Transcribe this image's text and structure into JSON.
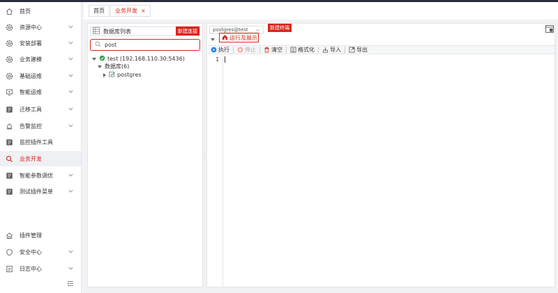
{
  "sidebar": {
    "items": [
      {
        "label": "首页",
        "icon": "home-icon",
        "expandable": false,
        "active": false
      },
      {
        "label": "资源中心",
        "icon": "gear-icon",
        "expandable": true,
        "active": false
      },
      {
        "label": "安装部署",
        "icon": "gear-icon",
        "expandable": true,
        "active": false
      },
      {
        "label": "业务建模",
        "icon": "gear-icon",
        "expandable": true,
        "active": false
      },
      {
        "label": "基础运维",
        "icon": "gear-icon",
        "expandable": true,
        "active": false
      },
      {
        "label": "智能运维",
        "icon": "monitor-icon",
        "expandable": true,
        "active": false
      },
      {
        "label": "迁移工具",
        "icon": "document-icon",
        "expandable": true,
        "active": false
      },
      {
        "label": "告警监控",
        "icon": "alarm-icon",
        "expandable": true,
        "active": false
      },
      {
        "label": "监控插件工具",
        "icon": "document-icon",
        "expandable": false,
        "active": false
      },
      {
        "label": "业务开发",
        "icon": "search-icon",
        "expandable": false,
        "active": true
      },
      {
        "label": "智能参数调优",
        "icon": "document-icon",
        "expandable": true,
        "active": false
      },
      {
        "label": "测试插件菜单",
        "icon": "document-icon",
        "expandable": true,
        "active": false
      }
    ],
    "bottom_items": [
      {
        "label": "插件管理",
        "icon": "plugin-icon",
        "expandable": false
      },
      {
        "label": "安全中心",
        "icon": "shield-icon",
        "expandable": true
      },
      {
        "label": "日志中心",
        "icon": "log-icon",
        "expandable": true
      }
    ]
  },
  "tabs": [
    {
      "label": "首页",
      "active": false,
      "closable": false
    },
    {
      "label": "业务开发",
      "active": true,
      "closable": true,
      "close_glyph": "×"
    }
  ],
  "db_panel": {
    "title": "数据库列表",
    "new_connection_label": "新建连接",
    "search_value": "post",
    "tree": {
      "connection": "test (192.168.110.30:5436)",
      "databases_label": "数据库(6)",
      "database": "postgres"
    }
  },
  "sql_panel": {
    "connection_select": "postgres@test",
    "new_terminal_label": "新建终端",
    "run_display_label": "运行及展示",
    "toolbar": {
      "execute": "执行",
      "stop": "停止",
      "clear": "清空",
      "format": "格式化",
      "import": "导入",
      "export": "导出"
    },
    "line_numbers": [
      "1"
    ]
  },
  "colors": {
    "accent": "#d9261c",
    "topbar": "#2b2d3a",
    "execute_blue": "#1e88e5",
    "tree_green": "#2e9e4f"
  }
}
